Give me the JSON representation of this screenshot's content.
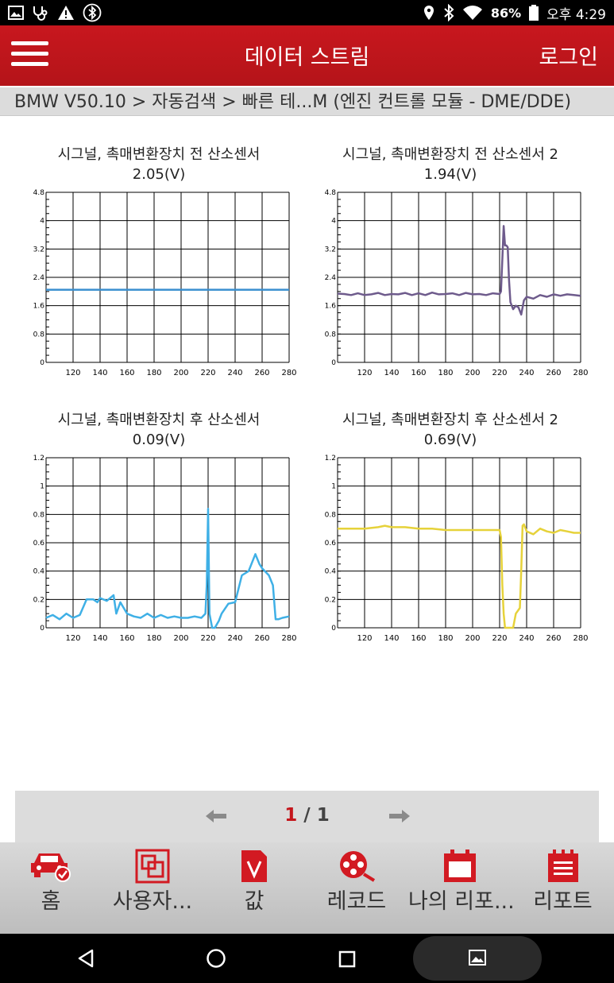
{
  "status_bar": {
    "battery": "86%",
    "time": "오후 4:29"
  },
  "app_bar": {
    "title": "데이터 스트림",
    "login": "로그인"
  },
  "breadcrumb": "BMW V50.10 > 자동검색 > 빠른 테...M (엔진 컨트롤 모듈 - DME/DDE)",
  "charts": [
    {
      "title": "시그널, 촉매변환장치 전 산소센서",
      "value": "2.05(V)"
    },
    {
      "title": "시그널, 촉매변환장치 전 산소센서 2",
      "value": "1.94(V)"
    },
    {
      "title": "시그널, 촉매변환장치 후 산소센서",
      "value": "0.09(V)"
    },
    {
      "title": "시그널, 촉매변환장치 후 산소센서 2",
      "value": "0.69(V)"
    }
  ],
  "chart_data": [
    {
      "type": "line",
      "title": "시그널, 촉매변환장치 전 산소센서",
      "xlim": [
        100,
        280
      ],
      "ylim": [
        0,
        4.8
      ],
      "xticks": [
        "120",
        "140",
        "160",
        "180",
        "200",
        "220",
        "240",
        "260",
        "280"
      ],
      "yticks": [
        "0",
        "0.8",
        "1.6",
        "2.4",
        "3.2",
        "4",
        "4.8"
      ],
      "grid": true,
      "color": "#3a8fcf",
      "x": [
        100,
        280
      ],
      "y": [
        2.05,
        2.05
      ]
    },
    {
      "type": "line",
      "title": "시그널, 촉매변환장치 전 산소센서 2",
      "xlim": [
        100,
        280
      ],
      "ylim": [
        0,
        4.8
      ],
      "xticks": [
        "120",
        "140",
        "160",
        "180",
        "200",
        "220",
        "240",
        "260",
        "280"
      ],
      "yticks": [
        "0",
        "0.8",
        "1.6",
        "2.4",
        "3.2",
        "4",
        "4.8"
      ],
      "grid": true,
      "color": "#6e5b8c",
      "x": [
        100,
        105,
        110,
        115,
        120,
        125,
        130,
        135,
        140,
        145,
        150,
        155,
        160,
        165,
        170,
        175,
        180,
        185,
        190,
        195,
        200,
        205,
        210,
        215,
        220,
        221,
        222,
        223,
        224,
        225,
        226,
        227,
        228,
        229,
        230,
        232,
        234,
        236,
        238,
        240,
        245,
        250,
        255,
        260,
        265,
        270,
        275,
        280
      ],
      "y": [
        1.94,
        1.93,
        1.9,
        1.95,
        1.9,
        1.92,
        1.96,
        1.9,
        1.93,
        1.92,
        1.96,
        1.9,
        1.95,
        1.9,
        1.97,
        1.92,
        1.93,
        1.95,
        1.9,
        1.96,
        1.92,
        1.93,
        1.9,
        1.95,
        1.93,
        2.0,
        2.9,
        3.85,
        3.3,
        3.3,
        3.25,
        2.3,
        1.7,
        1.6,
        1.5,
        1.6,
        1.55,
        1.35,
        1.75,
        1.85,
        1.8,
        1.9,
        1.85,
        1.92,
        1.88,
        1.92,
        1.9,
        1.88
      ]
    },
    {
      "type": "line",
      "title": "시그널, 촉매변환장치 후 산소센서",
      "xlim": [
        100,
        280
      ],
      "ylim": [
        0,
        1.2
      ],
      "xticks": [
        "120",
        "140",
        "160",
        "180",
        "200",
        "220",
        "240",
        "260",
        "280"
      ],
      "yticks": [
        "0",
        "0.2",
        "0.4",
        "0.6",
        "0.8",
        "1",
        "1.2"
      ],
      "grid": true,
      "color": "#3fb0e6",
      "x": [
        100,
        105,
        110,
        115,
        120,
        125,
        130,
        135,
        138,
        140,
        145,
        150,
        152,
        155,
        160,
        165,
        170,
        175,
        180,
        185,
        190,
        195,
        200,
        205,
        210,
        215,
        218,
        219,
        220,
        221,
        222,
        223,
        225,
        228,
        230,
        235,
        240,
        245,
        250,
        255,
        258,
        260,
        265,
        268,
        270,
        272,
        275,
        280
      ],
      "y": [
        0.07,
        0.09,
        0.06,
        0.1,
        0.07,
        0.09,
        0.2,
        0.2,
        0.18,
        0.21,
        0.19,
        0.23,
        0.1,
        0.18,
        0.1,
        0.08,
        0.07,
        0.1,
        0.07,
        0.09,
        0.07,
        0.08,
        0.07,
        0.07,
        0.08,
        0.07,
        0.1,
        0.3,
        0.84,
        0.1,
        0.05,
        0.0,
        0.0,
        0.05,
        0.1,
        0.17,
        0.18,
        0.37,
        0.4,
        0.52,
        0.45,
        0.42,
        0.37,
        0.3,
        0.06,
        0.06,
        0.07,
        0.08
      ]
    },
    {
      "type": "line",
      "title": "시그널, 촉매변환장치 후 산소센서 2",
      "xlim": [
        100,
        280
      ],
      "ylim": [
        0,
        1.2
      ],
      "xticks": [
        "120",
        "140",
        "160",
        "180",
        "200",
        "220",
        "240",
        "260",
        "280"
      ],
      "yticks": [
        "0",
        "0.2",
        "0.4",
        "0.6",
        "0.8",
        "1",
        "1.2"
      ],
      "grid": true,
      "color": "#e6d23a",
      "x": [
        100,
        110,
        120,
        130,
        135,
        140,
        150,
        160,
        170,
        180,
        190,
        200,
        210,
        215,
        220,
        221,
        222,
        223,
        224,
        225,
        230,
        232,
        235,
        236,
        237,
        238,
        240,
        245,
        250,
        255,
        260,
        265,
        270,
        275,
        280
      ],
      "y": [
        0.7,
        0.7,
        0.7,
        0.71,
        0.72,
        0.71,
        0.71,
        0.7,
        0.7,
        0.69,
        0.69,
        0.69,
        0.69,
        0.69,
        0.69,
        0.64,
        0.3,
        0.1,
        0.0,
        0.0,
        0.0,
        0.1,
        0.14,
        0.4,
        0.72,
        0.73,
        0.68,
        0.66,
        0.7,
        0.68,
        0.67,
        0.69,
        0.68,
        0.67,
        0.67
      ]
    }
  ],
  "pager": {
    "current": "1",
    "separator": "/",
    "total": "1"
  },
  "tabs": [
    {
      "label": "홈",
      "icon": "car-check-icon"
    },
    {
      "label": "사용자...",
      "icon": "user-custom-icon"
    },
    {
      "label": "값",
      "icon": "value-v-icon"
    },
    {
      "label": "레코드",
      "icon": "film-reel-icon"
    },
    {
      "label": "나의 리포...",
      "icon": "calendar-report-icon"
    },
    {
      "label": "리포트",
      "icon": "notepad-report-icon"
    }
  ],
  "colors": {
    "brand": "#c4161c"
  }
}
